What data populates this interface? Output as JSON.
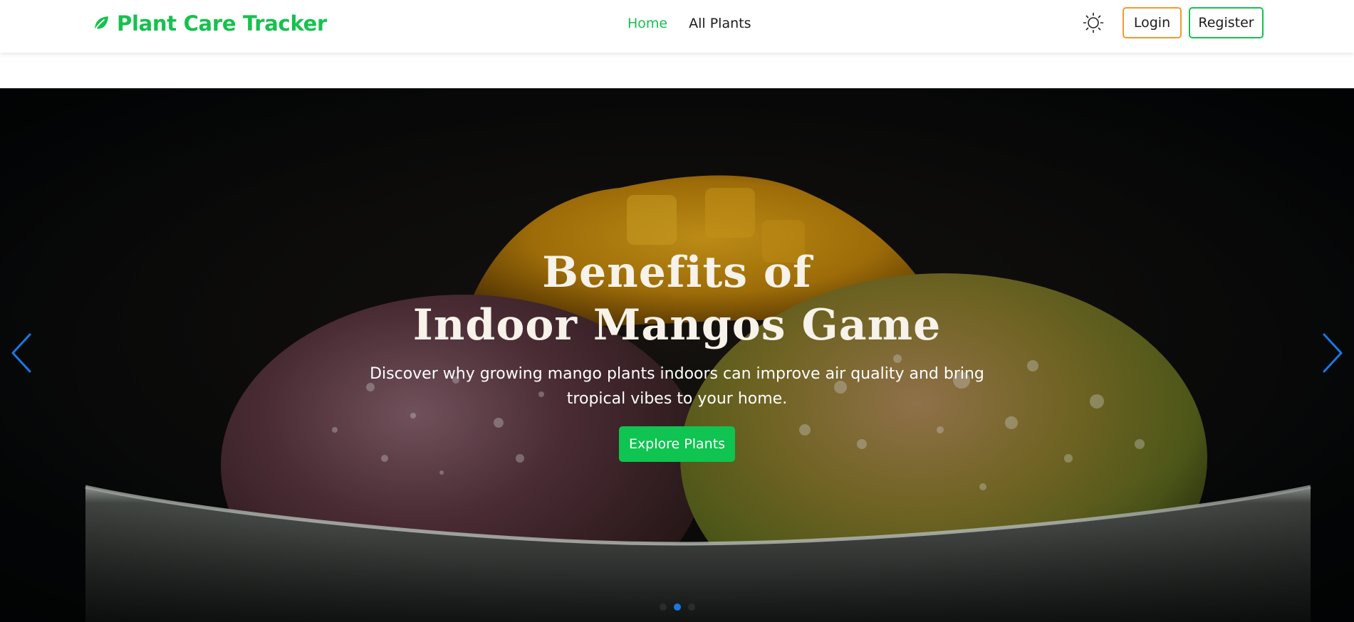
{
  "header": {
    "brand_name": "Plant Care Tracker",
    "brand_icon": "leaf-icon",
    "nav": [
      {
        "label": "Home",
        "active": true
      },
      {
        "label": "All Plants",
        "active": false
      }
    ],
    "theme_icon": "sun-icon",
    "login_label": "Login",
    "register_label": "Register"
  },
  "hero": {
    "title_line1": "Benefits of",
    "title_line2": "Indoor Mangos Game",
    "subtitle": "Discover why growing mango plants indoors can improve air quality and bring tropical vibes to your home.",
    "cta_label": "Explore Plants",
    "prev_icon": "chevron-left-icon",
    "next_icon": "chevron-right-icon",
    "slide_count": 3,
    "active_slide_index": 1
  },
  "colors": {
    "brand_green": "#16c14f",
    "cta_green": "#0fc451",
    "login_border": "#f29a2e",
    "arrow_blue": "#1679e6",
    "hero_background": "#07090b"
  }
}
